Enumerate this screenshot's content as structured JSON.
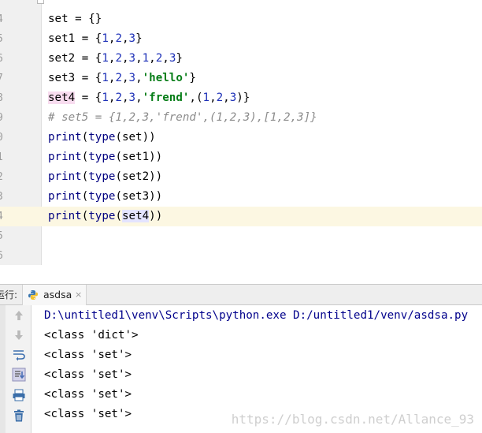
{
  "editor": {
    "lines": [
      {
        "num": "4",
        "tokens": [
          {
            "t": "set = {}",
            "c": ""
          }
        ]
      },
      {
        "num": "5",
        "tokens": [
          {
            "t": "set1 = {",
            "c": ""
          },
          {
            "t": "1",
            "c": "num"
          },
          {
            "t": ",",
            "c": ""
          },
          {
            "t": "2",
            "c": "num"
          },
          {
            "t": ",",
            "c": ""
          },
          {
            "t": "3",
            "c": "num"
          },
          {
            "t": "}",
            "c": ""
          }
        ]
      },
      {
        "num": "6",
        "tokens": [
          {
            "t": "set2 = {",
            "c": ""
          },
          {
            "t": "1",
            "c": "num"
          },
          {
            "t": ",",
            "c": ""
          },
          {
            "t": "2",
            "c": "num"
          },
          {
            "t": ",",
            "c": ""
          },
          {
            "t": "3",
            "c": "num"
          },
          {
            "t": ",",
            "c": ""
          },
          {
            "t": "1",
            "c": "num"
          },
          {
            "t": ",",
            "c": ""
          },
          {
            "t": "2",
            "c": "num"
          },
          {
            "t": ",",
            "c": ""
          },
          {
            "t": "3",
            "c": "num"
          },
          {
            "t": "}",
            "c": ""
          }
        ]
      },
      {
        "num": "7",
        "tokens": [
          {
            "t": "set3 = {",
            "c": ""
          },
          {
            "t": "1",
            "c": "num"
          },
          {
            "t": ",",
            "c": ""
          },
          {
            "t": "2",
            "c": "num"
          },
          {
            "t": ",",
            "c": ""
          },
          {
            "t": "3",
            "c": "num"
          },
          {
            "t": ",",
            "c": ""
          },
          {
            "t": "'hello'",
            "c": "str"
          },
          {
            "t": "}",
            "c": ""
          }
        ]
      },
      {
        "num": "8",
        "tokens": [
          {
            "t": "set4",
            "c": "hl-var"
          },
          {
            "t": " = {",
            "c": ""
          },
          {
            "t": "1",
            "c": "num"
          },
          {
            "t": ",",
            "c": ""
          },
          {
            "t": "2",
            "c": "num"
          },
          {
            "t": ",",
            "c": ""
          },
          {
            "t": "3",
            "c": "num"
          },
          {
            "t": ",",
            "c": ""
          },
          {
            "t": "'frend'",
            "c": "str"
          },
          {
            "t": ",(",
            "c": ""
          },
          {
            "t": "1",
            "c": "num"
          },
          {
            "t": ",",
            "c": ""
          },
          {
            "t": "2",
            "c": "num"
          },
          {
            "t": ",",
            "c": ""
          },
          {
            "t": "3",
            "c": "num"
          },
          {
            "t": ")}",
            "c": ""
          }
        ]
      },
      {
        "num": "9",
        "tokens": [
          {
            "t": "# set5 = {1,2,3,'frend',(1,2,3),[1,2,3]}",
            "c": "cmt"
          }
        ]
      },
      {
        "num": "0",
        "tokens": [
          {
            "t": "print",
            "c": "kw"
          },
          {
            "t": "(",
            "c": ""
          },
          {
            "t": "type",
            "c": "kw"
          },
          {
            "t": "(set))",
            "c": ""
          }
        ]
      },
      {
        "num": "1",
        "tokens": [
          {
            "t": "print",
            "c": "kw"
          },
          {
            "t": "(",
            "c": ""
          },
          {
            "t": "type",
            "c": "kw"
          },
          {
            "t": "(set1))",
            "c": ""
          }
        ]
      },
      {
        "num": "2",
        "tokens": [
          {
            "t": "print",
            "c": "kw"
          },
          {
            "t": "(",
            "c": ""
          },
          {
            "t": "type",
            "c": "kw"
          },
          {
            "t": "(set2))",
            "c": ""
          }
        ]
      },
      {
        "num": "3",
        "tokens": [
          {
            "t": "print",
            "c": "kw"
          },
          {
            "t": "(",
            "c": ""
          },
          {
            "t": "type",
            "c": "kw"
          },
          {
            "t": "(set3))",
            "c": ""
          }
        ]
      },
      {
        "num": "4",
        "current": true,
        "tokens": [
          {
            "t": "print",
            "c": "kw"
          },
          {
            "t": "(",
            "c": ""
          },
          {
            "t": "type",
            "c": "kw"
          },
          {
            "t": "(",
            "c": ""
          },
          {
            "t": "set4",
            "c": "hl-use"
          },
          {
            "t": "))",
            "c": ""
          }
        ]
      },
      {
        "num": "5",
        "tokens": []
      },
      {
        "num": "6",
        "tokens": []
      }
    ]
  },
  "run_panel": {
    "label": "运行:",
    "tab_name": "asdsa",
    "tab_close": "×",
    "toolbar": [
      "arrow-up-icon",
      "arrow-down-icon",
      "soft-wrap-icon",
      "scroll-to-end-icon",
      "print-icon",
      "trash-icon"
    ]
  },
  "console": {
    "lines": [
      {
        "text": "D:\\untitled1\\venv\\Scripts\\python.exe D:/untitled1/venv/asdsa.py",
        "kind": "path"
      },
      {
        "text": "<class 'dict'>",
        "kind": "out"
      },
      {
        "text": "<class 'set'>",
        "kind": "out"
      },
      {
        "text": "<class 'set'>",
        "kind": "out"
      },
      {
        "text": "<class 'set'>",
        "kind": "out"
      },
      {
        "text": "<class 'set'>",
        "kind": "out"
      }
    ],
    "watermark": "https://blog.csdn.net/Allance_93"
  },
  "colors": {
    "number": "#1f32b8",
    "string": "#067d17",
    "keyword": "#000080",
    "comment": "#8c8c8c",
    "current_line": "#fcf7e2"
  }
}
